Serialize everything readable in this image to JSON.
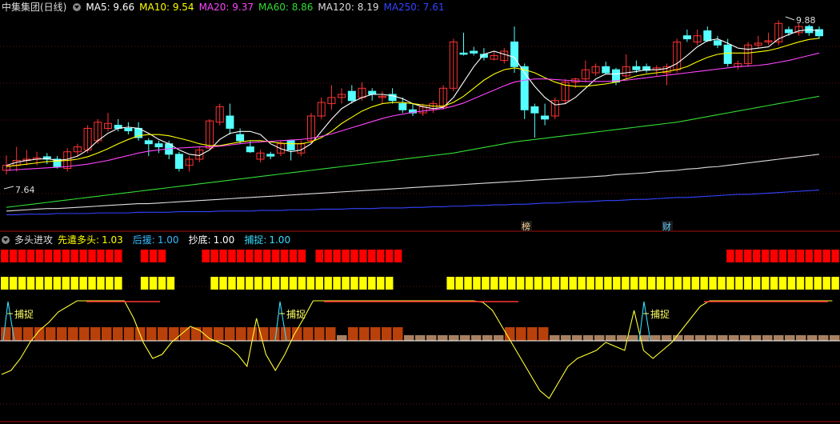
{
  "header": {
    "stock": "中集集团(日线)",
    "ma": [
      {
        "label": "MA5:",
        "value": "9.66",
        "color": "#ffffff"
      },
      {
        "label": "MA10:",
        "value": "9.54",
        "color": "#ffff00"
      },
      {
        "label": "MA20:",
        "value": "9.37",
        "color": "#ff44ff"
      },
      {
        "label": "MA60:",
        "value": "8.86",
        "color": "#33dd33"
      },
      {
        "label": "MA120:",
        "value": "8.19",
        "color": "#dddddd"
      },
      {
        "label": "MA250:",
        "value": "7.61",
        "color": "#3344ff"
      }
    ]
  },
  "indicator_header": {
    "name": "多头进攻",
    "items": [
      {
        "label": "先遣多头:",
        "value": "1.03",
        "color": "#ffff00"
      },
      {
        "label": "后援:",
        "value": "1.00",
        "color": "#33bbff"
      },
      {
        "label": "抄底:",
        "value": "1.00",
        "color": "#ffffff"
      },
      {
        "label": "捕捉:",
        "value": "1.00",
        "color": "#33ddff"
      }
    ]
  },
  "annotations": {
    "high_label": "9.88",
    "low_label": "7.64",
    "badge_1": "榜",
    "badge_2": "财",
    "catch_label": "捕捉"
  },
  "colors": {
    "up": "#ff3333",
    "down": "#55ffff",
    "red_block": "#ff0000",
    "yellow_block": "#ffff00",
    "brown_bar": "#b8400a",
    "tan_bar": "#a88060",
    "grid": "#661111"
  },
  "chart_data": {
    "type": "candlestick",
    "y_range": [
      6.75,
      10.25
    ],
    "ohlc": [
      [
        7.62,
        7.86,
        7.55,
        7.7
      ],
      [
        7.7,
        8.0,
        7.6,
        7.78
      ],
      [
        7.78,
        7.95,
        7.7,
        7.8
      ],
      [
        7.8,
        7.92,
        7.7,
        7.82
      ],
      [
        7.84,
        7.9,
        7.72,
        7.8
      ],
      [
        7.8,
        7.85,
        7.65,
        7.68
      ],
      [
        7.65,
        7.98,
        7.6,
        7.92
      ],
      [
        7.92,
        8.05,
        7.85,
        8.0
      ],
      [
        7.95,
        8.35,
        7.9,
        8.3
      ],
      [
        8.1,
        8.45,
        8.05,
        8.4
      ],
      [
        8.3,
        8.55,
        8.25,
        8.38
      ],
      [
        8.35,
        8.45,
        8.25,
        8.3
      ],
      [
        8.3,
        8.4,
        8.2,
        8.26
      ],
      [
        8.3,
        8.4,
        8.1,
        8.15
      ],
      [
        8.1,
        8.14,
        7.85,
        8.05
      ],
      [
        8.05,
        8.1,
        7.9,
        8.0
      ],
      [
        8.05,
        8.1,
        7.8,
        7.88
      ],
      [
        7.88,
        7.92,
        7.6,
        7.65
      ],
      [
        7.7,
        7.85,
        7.6,
        7.8
      ],
      [
        7.8,
        8.0,
        7.75,
        7.95
      ],
      [
        7.98,
        8.45,
        7.95,
        8.42
      ],
      [
        8.4,
        8.7,
        8.35,
        8.65
      ],
      [
        8.5,
        8.7,
        8.2,
        8.3
      ],
      [
        8.2,
        8.3,
        8.05,
        8.1
      ],
      [
        8.0,
        8.1,
        7.9,
        7.92
      ],
      [
        7.8,
        7.95,
        7.75,
        7.9
      ],
      [
        7.88,
        7.92,
        7.8,
        7.85
      ],
      [
        7.9,
        8.1,
        7.85,
        8.05
      ],
      [
        8.1,
        8.12,
        7.78,
        7.95
      ],
      [
        7.9,
        8.1,
        7.85,
        8.05
      ],
      [
        8.1,
        8.55,
        8.05,
        8.5
      ],
      [
        8.5,
        8.8,
        8.45,
        8.72
      ],
      [
        8.7,
        9.0,
        8.6,
        8.8
      ],
      [
        8.8,
        8.95,
        8.7,
        8.85
      ],
      [
        8.9,
        9.0,
        8.7,
        8.75
      ],
      [
        8.8,
        9.05,
        8.75,
        8.95
      ],
      [
        8.9,
        8.95,
        8.75,
        8.85
      ],
      [
        8.8,
        8.9,
        8.7,
        8.82
      ],
      [
        8.85,
        8.95,
        8.7,
        8.75
      ],
      [
        8.7,
        8.8,
        8.55,
        8.6
      ],
      [
        8.6,
        8.7,
        8.5,
        8.55
      ],
      [
        8.55,
        8.7,
        8.5,
        8.65
      ],
      [
        8.6,
        8.75,
        8.55,
        8.7
      ],
      [
        8.65,
        9.0,
        8.6,
        8.95
      ],
      [
        8.95,
        9.75,
        8.9,
        9.7
      ],
      [
        9.52,
        9.85,
        9.48,
        9.5
      ],
      [
        9.55,
        9.62,
        9.48,
        9.52
      ],
      [
        9.5,
        9.6,
        9.4,
        9.45
      ],
      [
        9.42,
        9.55,
        9.4,
        9.48
      ],
      [
        9.4,
        9.6,
        9.35,
        9.55
      ],
      [
        9.7,
        9.95,
        9.2,
        9.3
      ],
      [
        9.3,
        9.35,
        8.45,
        8.6
      ],
      [
        8.65,
        8.7,
        8.15,
        8.55
      ],
      [
        8.5,
        8.7,
        8.35,
        8.45
      ],
      [
        8.5,
        8.8,
        8.45,
        8.75
      ],
      [
        8.75,
        9.1,
        8.7,
        9.05
      ],
      [
        9.05,
        9.12,
        8.95,
        9.1
      ],
      [
        9.1,
        9.4,
        9.05,
        9.25
      ],
      [
        9.2,
        9.35,
        9.15,
        9.3
      ],
      [
        9.3,
        9.38,
        9.18,
        9.2
      ],
      [
        9.25,
        9.28,
        9.0,
        9.05
      ],
      [
        9.15,
        9.5,
        9.1,
        9.3
      ],
      [
        9.3,
        9.4,
        9.2,
        9.25
      ],
      [
        9.3,
        9.35,
        9.2,
        9.24
      ],
      [
        9.25,
        9.32,
        9.15,
        9.28
      ],
      [
        9.2,
        9.35,
        9.0,
        9.3
      ],
      [
        9.25,
        9.75,
        9.2,
        9.7
      ],
      [
        9.8,
        9.9,
        9.7,
        9.75
      ],
      [
        9.7,
        9.9,
        9.65,
        9.8
      ],
      [
        9.88,
        9.95,
        9.7,
        9.72
      ],
      [
        9.72,
        9.8,
        9.6,
        9.65
      ],
      [
        9.65,
        9.75,
        9.3,
        9.35
      ],
      [
        9.3,
        9.4,
        9.25,
        9.35
      ],
      [
        9.35,
        9.7,
        9.3,
        9.65
      ],
      [
        9.65,
        9.8,
        9.6,
        9.68
      ],
      [
        9.7,
        9.85,
        9.65,
        9.72
      ],
      [
        9.7,
        10.05,
        9.65,
        10.0
      ],
      [
        9.9,
        9.95,
        9.8,
        9.85
      ],
      [
        9.85,
        10.0,
        9.8,
        9.95
      ],
      [
        9.95,
        9.98,
        9.8,
        9.85
      ],
      [
        9.9,
        9.95,
        9.75,
        9.8
      ]
    ],
    "lines": [
      {
        "name": "MA5",
        "color": "#ffffff",
        "values": [
          7.7,
          7.75,
          7.78,
          7.8,
          7.81,
          7.78,
          7.8,
          7.85,
          7.95,
          8.1,
          8.22,
          8.3,
          8.32,
          8.3,
          8.22,
          8.12,
          8.05,
          7.95,
          7.88,
          7.86,
          7.95,
          8.12,
          8.22,
          8.25,
          8.25,
          8.2,
          8.05,
          7.97,
          7.92,
          7.95,
          8.05,
          8.25,
          8.45,
          8.62,
          8.72,
          8.8,
          8.85,
          8.85,
          8.83,
          8.78,
          8.7,
          8.65,
          8.62,
          8.64,
          8.8,
          9.05,
          9.3,
          9.5,
          9.55,
          9.5,
          9.45,
          9.2,
          8.98,
          8.8,
          8.68,
          8.7,
          8.8,
          8.95,
          9.1,
          9.18,
          9.18,
          9.2,
          9.22,
          9.25,
          9.25,
          9.27,
          9.35,
          9.48,
          9.62,
          9.72,
          9.75,
          9.68,
          9.6,
          9.58,
          9.6,
          9.62,
          9.75,
          9.82,
          9.88,
          9.9,
          9.88
        ]
      },
      {
        "name": "MA10",
        "color": "#ffff00",
        "values": [
          7.68,
          7.7,
          7.72,
          7.74,
          7.76,
          7.77,
          7.78,
          7.8,
          7.84,
          7.9,
          7.97,
          8.05,
          8.12,
          8.18,
          8.2,
          8.2,
          8.18,
          8.14,
          8.1,
          8.05,
          8.02,
          8.02,
          8.05,
          8.08,
          8.1,
          8.1,
          8.08,
          8.06,
          8.05,
          8.05,
          8.08,
          8.15,
          8.25,
          8.38,
          8.48,
          8.58,
          8.65,
          8.7,
          8.72,
          8.72,
          8.7,
          8.68,
          8.66,
          8.66,
          8.72,
          8.82,
          8.95,
          9.08,
          9.18,
          9.25,
          9.28,
          9.25,
          9.2,
          9.12,
          9.05,
          9.0,
          8.98,
          8.98,
          9.0,
          9.02,
          9.05,
          9.1,
          9.15,
          9.18,
          9.2,
          9.22,
          9.25,
          9.3,
          9.38,
          9.45,
          9.5,
          9.52,
          9.52,
          9.52,
          9.54,
          9.56,
          9.6,
          9.65,
          9.7,
          9.74,
          9.76
        ]
      },
      {
        "name": "MA20",
        "color": "#ff44ff",
        "values": [
          7.62,
          7.63,
          7.64,
          7.65,
          7.66,
          7.67,
          7.68,
          7.7,
          7.72,
          7.75,
          7.78,
          7.82,
          7.86,
          7.9,
          7.93,
          7.95,
          7.97,
          7.98,
          7.99,
          8.0,
          8.0,
          8.01,
          8.03,
          8.05,
          8.07,
          8.08,
          8.09,
          8.1,
          8.11,
          8.12,
          8.14,
          8.17,
          8.21,
          8.26,
          8.31,
          8.36,
          8.41,
          8.46,
          8.5,
          8.53,
          8.56,
          8.58,
          8.6,
          8.62,
          8.66,
          8.71,
          8.78,
          8.85,
          8.92,
          8.99,
          9.05,
          9.08,
          9.1,
          9.1,
          9.09,
          9.08,
          9.07,
          9.06,
          9.06,
          9.06,
          9.07,
          9.08,
          9.1,
          9.12,
          9.14,
          9.16,
          9.18,
          9.2,
          9.22,
          9.24,
          9.26,
          9.28,
          9.3,
          9.31,
          9.32,
          9.34,
          9.37,
          9.4,
          9.44,
          9.48,
          9.52
        ]
      },
      {
        "name": "MA60",
        "color": "#33dd33",
        "values": [
          7.02,
          7.04,
          7.06,
          7.08,
          7.1,
          7.12,
          7.14,
          7.16,
          7.18,
          7.2,
          7.22,
          7.24,
          7.26,
          7.28,
          7.3,
          7.32,
          7.34,
          7.36,
          7.38,
          7.4,
          7.42,
          7.44,
          7.46,
          7.48,
          7.5,
          7.52,
          7.54,
          7.56,
          7.58,
          7.6,
          7.62,
          7.64,
          7.66,
          7.68,
          7.7,
          7.72,
          7.74,
          7.76,
          7.78,
          7.8,
          7.82,
          7.84,
          7.86,
          7.88,
          7.9,
          7.93,
          7.96,
          7.99,
          8.02,
          8.05,
          8.08,
          8.1,
          8.12,
          8.14,
          8.16,
          8.18,
          8.2,
          8.22,
          8.24,
          8.26,
          8.28,
          8.3,
          8.32,
          8.34,
          8.36,
          8.38,
          8.4,
          8.43,
          8.46,
          8.49,
          8.52,
          8.55,
          8.58,
          8.61,
          8.64,
          8.67,
          8.7,
          8.73,
          8.76,
          8.79,
          8.82
        ]
      },
      {
        "name": "MA120",
        "color": "#dddddd",
        "values": [
          6.96,
          6.97,
          6.98,
          6.99,
          7.0,
          7.0,
          7.01,
          7.02,
          7.03,
          7.04,
          7.05,
          7.06,
          7.07,
          7.08,
          7.08,
          7.09,
          7.1,
          7.11,
          7.12,
          7.13,
          7.14,
          7.15,
          7.16,
          7.17,
          7.18,
          7.19,
          7.2,
          7.21,
          7.22,
          7.23,
          7.24,
          7.25,
          7.26,
          7.27,
          7.28,
          7.29,
          7.3,
          7.31,
          7.32,
          7.33,
          7.34,
          7.35,
          7.36,
          7.37,
          7.38,
          7.39,
          7.4,
          7.41,
          7.42,
          7.43,
          7.44,
          7.45,
          7.46,
          7.47,
          7.48,
          7.49,
          7.5,
          7.51,
          7.52,
          7.53,
          7.55,
          7.56,
          7.57,
          7.58,
          7.6,
          7.61,
          7.62,
          7.64,
          7.65,
          7.67,
          7.68,
          7.7,
          7.72,
          7.74,
          7.76,
          7.78,
          7.8,
          7.82,
          7.84,
          7.86,
          7.88
        ]
      },
      {
        "name": "MA250",
        "color": "#3344ff",
        "values": [
          6.9,
          6.9,
          6.91,
          6.91,
          6.91,
          6.92,
          6.92,
          6.92,
          6.92,
          6.93,
          6.93,
          6.93,
          6.93,
          6.94,
          6.94,
          6.94,
          6.94,
          6.95,
          6.95,
          6.95,
          6.95,
          6.96,
          6.96,
          6.96,
          6.96,
          6.97,
          6.97,
          6.97,
          6.98,
          6.98,
          6.98,
          6.99,
          6.99,
          6.99,
          7.0,
          7.0,
          7.0,
          7.01,
          7.01,
          7.01,
          7.02,
          7.02,
          7.03,
          7.03,
          7.04,
          7.04,
          7.05,
          7.05,
          7.06,
          7.06,
          7.07,
          7.07,
          7.08,
          7.09,
          7.09,
          7.1,
          7.11,
          7.11,
          7.12,
          7.13,
          7.13,
          7.14,
          7.15,
          7.15,
          7.16,
          7.17,
          7.18,
          7.18,
          7.19,
          7.2,
          7.21,
          7.22,
          7.23,
          7.23,
          7.24,
          7.25,
          7.26,
          7.27,
          7.28,
          7.29,
          7.3
        ]
      }
    ],
    "red_blocks": [
      1,
      1,
      1,
      1,
      1,
      1,
      1,
      1,
      1,
      1,
      1,
      1,
      1,
      1,
      0,
      0,
      1,
      1,
      1,
      0,
      0,
      0,
      0,
      1,
      1,
      1,
      1,
      1,
      1,
      1,
      1,
      1,
      1,
      1,
      1,
      0,
      1,
      1,
      1,
      1,
      1,
      1,
      1,
      1,
      1,
      1,
      0,
      0,
      0,
      0,
      0,
      0,
      0,
      0,
      0,
      0,
      0,
      0,
      0,
      0,
      0,
      0,
      0,
      0,
      0,
      0,
      0,
      0,
      0,
      0,
      0,
      0,
      0,
      0,
      0,
      0,
      0,
      0,
      0,
      0,
      0,
      0,
      0,
      1,
      1,
      1,
      1,
      1,
      1,
      1,
      1,
      1,
      1,
      1,
      1,
      1,
      1,
      1,
      1,
      1,
      1
    ],
    "yellow_blocks": [
      1,
      1,
      1,
      1,
      1,
      1,
      1,
      1,
      1,
      1,
      1,
      1,
      1,
      1,
      0,
      0,
      1,
      1,
      1,
      1,
      0,
      0,
      0,
      0,
      1,
      1,
      1,
      1,
      1,
      1,
      1,
      1,
      1,
      1,
      1,
      1,
      1,
      1,
      1,
      1,
      1,
      1,
      1,
      1,
      1,
      0,
      0,
      0,
      0,
      0,
      0,
      1,
      1,
      1,
      1,
      1,
      1,
      1,
      1,
      1,
      1,
      1,
      1,
      1,
      1,
      1,
      1,
      1,
      1,
      1,
      1,
      1,
      1,
      1,
      1,
      1,
      1,
      1,
      1,
      1,
      1,
      1,
      1,
      1,
      1,
      1,
      1,
      1,
      1,
      1,
      1,
      1,
      1,
      1,
      1,
      1,
      1
    ],
    "brown_bars": [
      2,
      2,
      2,
      2,
      2,
      2,
      2,
      2,
      2,
      2,
      2,
      2,
      2,
      2,
      2,
      2,
      2,
      2,
      2,
      2,
      2,
      2,
      2,
      2,
      2,
      2,
      2,
      2,
      2,
      2,
      1,
      2,
      2,
      2,
      2,
      2,
      1,
      1,
      1,
      1,
      1,
      1,
      1,
      1,
      1,
      2,
      2,
      2,
      2,
      1,
      1,
      1,
      1,
      1,
      1,
      1,
      1,
      1,
      1,
      1,
      1,
      1,
      1,
      1,
      1,
      1,
      1,
      1,
      1,
      1,
      1,
      1,
      1,
      1,
      1
    ],
    "osc_y": [
      30,
      25,
      10,
      -10,
      -25,
      -35,
      -48,
      -55,
      -62,
      -62,
      -62,
      -62,
      -62,
      -62,
      -40,
      -10,
      10,
      5,
      -10,
      -20,
      -30,
      -25,
      -15,
      -10,
      -5,
      5,
      20,
      -40,
      5,
      25,
      5,
      -20,
      -40,
      -62,
      -62,
      -62,
      -62,
      -62,
      -62,
      -62,
      -62,
      -62,
      -62,
      -62,
      -62,
      -62,
      -62,
      -62,
      -62,
      -62,
      -62,
      -60,
      -50,
      -30,
      -10,
      10,
      30,
      50,
      60,
      40,
      20,
      10,
      5,
      0,
      -10,
      -5,
      0,
      -50,
      0,
      10,
      0,
      -10,
      -25,
      -40,
      -55,
      -62,
      -62,
      -62,
      -62,
      -62,
      -62,
      -62,
      -62,
      -62,
      -62,
      -62,
      -62,
      -62,
      -62
    ],
    "catch_x": [
      12,
      352,
      807
    ]
  }
}
